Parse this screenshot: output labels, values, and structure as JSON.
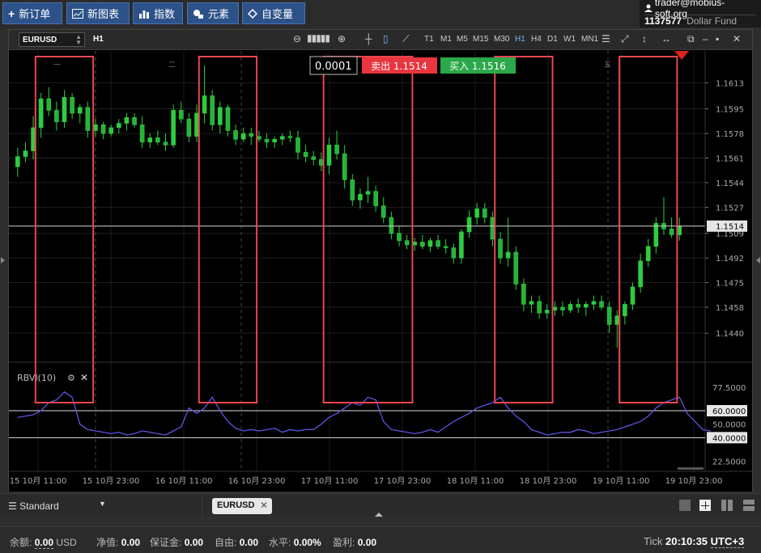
{
  "toolbar": {
    "new_order": "新订单",
    "new_chart": "新图表",
    "indicators": "指数",
    "elements": "元素",
    "variables": "自变量"
  },
  "account": {
    "email": "trader@mobius-soft.org",
    "id": "1137577",
    "fund": "Dollar Fund"
  },
  "chart_toolbar": {
    "symbol": "EURUSD",
    "timeframe": "H1",
    "timeframes": [
      "T1",
      "M1",
      "M5",
      "M15",
      "M30",
      "H1",
      "H4",
      "D1",
      "W1",
      "MN1"
    ],
    "active_timeframe": "H1"
  },
  "trade": {
    "volume": "0.0001",
    "sell_label": "卖出 1.1514",
    "buy_label": "买入 1.1516",
    "sell_color": "#e8353f",
    "buy_color": "#2aa84a"
  },
  "day_labels": [
    "一",
    "二",
    "五"
  ],
  "indicator": {
    "name": "RBVI(10)",
    "levels": [
      "77.5000",
      "60.0000",
      "50.0000",
      "40.0000",
      "22.5000"
    ]
  },
  "chart_data": {
    "type": "candlestick",
    "symbol": "EURUSD",
    "current_price": "1.1514",
    "price_ticks": [
      "1.1613",
      "1.1595",
      "1.1578",
      "1.1561",
      "1.1544",
      "1.1527",
      "1.1509",
      "1.1492",
      "1.1475",
      "1.1458",
      "1.1440"
    ],
    "time_ticks": [
      "15 10月 11:00",
      "15 10月 23:00",
      "16 10月 11:00",
      "16 10月 23:00",
      "17 10月 11:00",
      "17 10月 23:00",
      "18 10月 11:00",
      "18 10月 23:00",
      "19 10月 11:00",
      "19 10月 23:00"
    ],
    "candles": [
      [
        1.1555,
        1.1568,
        1.1548,
        1.1562
      ],
      [
        1.1562,
        1.1572,
        1.1558,
        1.1566
      ],
      [
        1.1566,
        1.159,
        1.156,
        1.1582
      ],
      [
        1.1582,
        1.1606,
        1.1575,
        1.1602
      ],
      [
        1.1602,
        1.161,
        1.159,
        1.1594
      ],
      [
        1.1594,
        1.16,
        1.158,
        1.1586
      ],
      [
        1.1586,
        1.1608,
        1.1582,
        1.1603
      ],
      [
        1.1603,
        1.1606,
        1.1588,
        1.1592
      ],
      [
        1.1592,
        1.1598,
        1.1585,
        1.1596
      ],
      [
        1.1596,
        1.16,
        1.1575,
        1.158
      ],
      [
        1.158,
        1.1588,
        1.1576,
        1.1584
      ],
      [
        1.1584,
        1.1586,
        1.1574,
        1.1578
      ],
      [
        1.1578,
        1.1584,
        1.1576,
        1.1582
      ],
      [
        1.1582,
        1.1588,
        1.1578,
        1.1585
      ],
      [
        1.1585,
        1.1592,
        1.158,
        1.1589
      ],
      [
        1.1589,
        1.1592,
        1.1582,
        1.1584
      ],
      [
        1.1584,
        1.159,
        1.1568,
        1.1572
      ],
      [
        1.1572,
        1.1578,
        1.1568,
        1.1575
      ],
      [
        1.1575,
        1.158,
        1.157,
        1.1572
      ],
      [
        1.1572,
        1.1578,
        1.1566,
        1.157
      ],
      [
        1.157,
        1.1598,
        1.1568,
        1.1594
      ],
      [
        1.1594,
        1.16,
        1.1585,
        1.1588
      ],
      [
        1.1588,
        1.1592,
        1.1572,
        1.1576
      ],
      [
        1.1576,
        1.1598,
        1.1572,
        1.1592
      ],
      [
        1.1592,
        1.1625,
        1.1585,
        1.1604
      ],
      [
        1.1604,
        1.1608,
        1.158,
        1.1584
      ],
      [
        1.1584,
        1.16,
        1.1578,
        1.1596
      ],
      [
        1.1596,
        1.1598,
        1.1576,
        1.158
      ],
      [
        1.158,
        1.1584,
        1.157,
        1.1574
      ],
      [
        1.1574,
        1.1582,
        1.1572,
        1.1578
      ],
      [
        1.1578,
        1.1582,
        1.157,
        1.1576
      ],
      [
        1.1576,
        1.158,
        1.1572,
        1.1574
      ],
      [
        1.1574,
        1.1578,
        1.1568,
        1.1572
      ],
      [
        1.1572,
        1.1576,
        1.1568,
        1.1574
      ],
      [
        1.1574,
        1.1578,
        1.157,
        1.1576
      ],
      [
        1.1576,
        1.158,
        1.1572,
        1.1575
      ],
      [
        1.1575,
        1.158,
        1.156,
        1.1565
      ],
      [
        1.1565,
        1.157,
        1.1558,
        1.1562
      ],
      [
        1.1562,
        1.1566,
        1.1556,
        1.156
      ],
      [
        1.156,
        1.1565,
        1.1552,
        1.1556
      ],
      [
        1.1556,
        1.1575,
        1.155,
        1.157
      ],
      [
        1.157,
        1.158,
        1.156,
        1.1564
      ],
      [
        1.1564,
        1.157,
        1.154,
        1.1546
      ],
      [
        1.1546,
        1.155,
        1.1528,
        1.1532
      ],
      [
        1.1532,
        1.154,
        1.1526,
        1.1536
      ],
      [
        1.1536,
        1.1548,
        1.153,
        1.1538
      ],
      [
        1.1538,
        1.1542,
        1.1524,
        1.1528
      ],
      [
        1.1528,
        1.1534,
        1.1516,
        1.152
      ],
      [
        1.152,
        1.1524,
        1.1505,
        1.1509
      ],
      [
        1.1509,
        1.1514,
        1.15,
        1.1504
      ],
      [
        1.1504,
        1.1508,
        1.1498,
        1.1501
      ],
      [
        1.1501,
        1.1506,
        1.1497,
        1.1503
      ],
      [
        1.1503,
        1.1508,
        1.1498,
        1.15
      ],
      [
        1.15,
        1.1506,
        1.1496,
        1.1504
      ],
      [
        1.1504,
        1.1508,
        1.1498,
        1.15
      ],
      [
        1.15,
        1.1505,
        1.1495,
        1.1499
      ],
      [
        1.1499,
        1.1502,
        1.1488,
        1.1492
      ],
      [
        1.1492,
        1.1512,
        1.1488,
        1.151
      ],
      [
        1.151,
        1.1525,
        1.1506,
        1.152
      ],
      [
        1.152,
        1.153,
        1.1515,
        1.1526
      ],
      [
        1.1526,
        1.153,
        1.1516,
        1.152
      ],
      [
        1.152,
        1.1524,
        1.15,
        1.1505
      ],
      [
        1.1505,
        1.151,
        1.1488,
        1.1492
      ],
      [
        1.1492,
        1.152,
        1.1486,
        1.1496
      ],
      [
        1.1496,
        1.15,
        1.147,
        1.1474
      ],
      [
        1.1474,
        1.1478,
        1.1455,
        1.146
      ],
      [
        1.146,
        1.1466,
        1.1454,
        1.1462
      ],
      [
        1.1462,
        1.1466,
        1.145,
        1.1454
      ],
      [
        1.1454,
        1.146,
        1.145,
        1.1456
      ],
      [
        1.1456,
        1.1462,
        1.1452,
        1.1458
      ],
      [
        1.1458,
        1.1462,
        1.1452,
        1.1456
      ],
      [
        1.1456,
        1.1462,
        1.1454,
        1.146
      ],
      [
        1.146,
        1.1464,
        1.1454,
        1.1458
      ],
      [
        1.1458,
        1.1462,
        1.1452,
        1.146
      ],
      [
        1.146,
        1.1466,
        1.1456,
        1.1462
      ],
      [
        1.1462,
        1.1466,
        1.1456,
        1.1458
      ],
      [
        1.1458,
        1.1462,
        1.144,
        1.1446
      ],
      [
        1.1446,
        1.1456,
        1.143,
        1.1452
      ],
      [
        1.1452,
        1.1462,
        1.1446,
        1.146
      ],
      [
        1.146,
        1.1475,
        1.1456,
        1.1472
      ],
      [
        1.1472,
        1.1495,
        1.1468,
        1.149
      ],
      [
        1.149,
        1.1505,
        1.1486,
        1.15
      ],
      [
        1.15,
        1.152,
        1.1495,
        1.1516
      ],
      [
        1.1516,
        1.1534,
        1.1508,
        1.1512
      ],
      [
        1.1512,
        1.152,
        1.1506,
        1.1508
      ],
      [
        1.1508,
        1.152,
        1.1504,
        1.1514
      ]
    ],
    "highlight_boxes": [
      {
        "from": 3,
        "to": 9
      },
      {
        "from": 24,
        "to": 30
      },
      {
        "from": 40,
        "to": 50
      },
      {
        "from": 62,
        "to": 68
      },
      {
        "from": 78,
        "to": 84
      }
    ],
    "indicator_values": [
      55,
      56,
      57,
      60,
      66,
      68,
      74,
      70,
      50,
      46,
      45,
      44,
      43,
      44,
      42,
      43,
      45,
      44,
      43,
      42,
      45,
      48,
      62,
      58,
      62,
      70,
      60,
      52,
      47,
      45,
      46,
      45,
      46,
      47,
      44,
      46,
      45,
      46,
      46,
      50,
      55,
      58,
      62,
      66,
      64,
      70,
      68,
      52,
      46,
      45,
      44,
      43,
      44,
      46,
      44,
      48,
      52,
      55,
      58,
      62,
      64,
      66,
      70,
      62,
      56,
      52,
      46,
      44,
      42,
      43,
      44,
      44,
      46,
      45,
      43,
      44,
      45,
      46,
      48,
      50,
      52,
      56,
      62,
      66,
      68,
      70,
      58,
      52,
      46,
      45
    ],
    "indicator_ylim": [
      15,
      90
    ],
    "price_ylim": [
      1.142,
      1.1635
    ]
  },
  "tabs": {
    "layout": "Standard",
    "symbol_tab": "EURUSD"
  },
  "status": {
    "balance_label": "余额:",
    "balance": "0.00",
    "currency": "USD",
    "equity_label": "净值:",
    "equity": "0.00",
    "margin_label": "保证金:",
    "margin": "0.00",
    "free_label": "自由:",
    "free": "0.00",
    "level_label": "水平:",
    "level": "0.00%",
    "profit_label": "盈利:",
    "profit": "0.00",
    "tick_label": "Tick",
    "time": "20:10:35",
    "tz": "UTC+3"
  }
}
